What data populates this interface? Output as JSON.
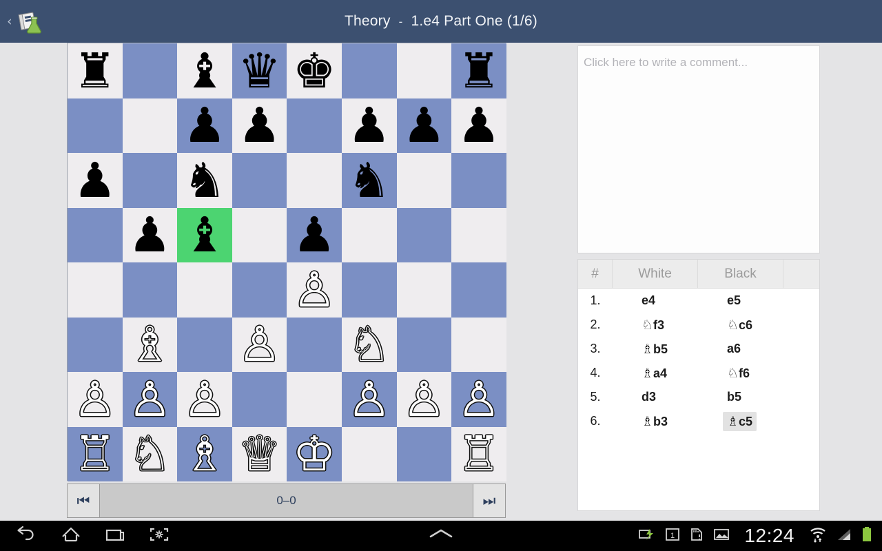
{
  "titlebar": {
    "back_label": "‹",
    "app_icon": "book-flask-icon",
    "title": "Theory",
    "separator": "-",
    "subtitle": "1.e4 Part One (1/6)"
  },
  "board": {
    "highlight_square": "c5",
    "squares": [
      {
        "sq": "a8",
        "shade": "light",
        "piece": "♜"
      },
      {
        "sq": "b8",
        "shade": "dark",
        "piece": ""
      },
      {
        "sq": "c8",
        "shade": "light",
        "piece": "♝"
      },
      {
        "sq": "d8",
        "shade": "dark",
        "piece": "♛"
      },
      {
        "sq": "e8",
        "shade": "light",
        "piece": "♚"
      },
      {
        "sq": "f8",
        "shade": "dark",
        "piece": ""
      },
      {
        "sq": "g8",
        "shade": "light",
        "piece": ""
      },
      {
        "sq": "h8",
        "shade": "dark",
        "piece": "♜"
      },
      {
        "sq": "a7",
        "shade": "dark",
        "piece": ""
      },
      {
        "sq": "b7",
        "shade": "light",
        "piece": ""
      },
      {
        "sq": "c7",
        "shade": "dark",
        "piece": "♟"
      },
      {
        "sq": "d7",
        "shade": "light",
        "piece": "♟"
      },
      {
        "sq": "e7",
        "shade": "dark",
        "piece": ""
      },
      {
        "sq": "f7",
        "shade": "light",
        "piece": "♟"
      },
      {
        "sq": "g7",
        "shade": "dark",
        "piece": "♟"
      },
      {
        "sq": "h7",
        "shade": "light",
        "piece": "♟"
      },
      {
        "sq": "a6",
        "shade": "light",
        "piece": "♟"
      },
      {
        "sq": "b6",
        "shade": "dark",
        "piece": ""
      },
      {
        "sq": "c6",
        "shade": "light",
        "piece": "♞"
      },
      {
        "sq": "d6",
        "shade": "dark",
        "piece": ""
      },
      {
        "sq": "e6",
        "shade": "light",
        "piece": ""
      },
      {
        "sq": "f6",
        "shade": "dark",
        "piece": "♞"
      },
      {
        "sq": "g6",
        "shade": "light",
        "piece": ""
      },
      {
        "sq": "h6",
        "shade": "dark",
        "piece": ""
      },
      {
        "sq": "a5",
        "shade": "dark",
        "piece": ""
      },
      {
        "sq": "b5",
        "shade": "light",
        "piece": "♟"
      },
      {
        "sq": "c5",
        "shade": "hl",
        "piece": "♝"
      },
      {
        "sq": "d5",
        "shade": "light",
        "piece": ""
      },
      {
        "sq": "e5",
        "shade": "dark",
        "piece": "♟"
      },
      {
        "sq": "f5",
        "shade": "light",
        "piece": ""
      },
      {
        "sq": "g5",
        "shade": "dark",
        "piece": ""
      },
      {
        "sq": "h5",
        "shade": "light",
        "piece": ""
      },
      {
        "sq": "a4",
        "shade": "light",
        "piece": ""
      },
      {
        "sq": "b4",
        "shade": "dark",
        "piece": ""
      },
      {
        "sq": "c4",
        "shade": "light",
        "piece": ""
      },
      {
        "sq": "d4",
        "shade": "dark",
        "piece": ""
      },
      {
        "sq": "e4",
        "shade": "light",
        "piece": "♙"
      },
      {
        "sq": "f4",
        "shade": "dark",
        "piece": ""
      },
      {
        "sq": "g4",
        "shade": "light",
        "piece": ""
      },
      {
        "sq": "h4",
        "shade": "dark",
        "piece": ""
      },
      {
        "sq": "a3",
        "shade": "dark",
        "piece": ""
      },
      {
        "sq": "b3",
        "shade": "light",
        "piece": "♗"
      },
      {
        "sq": "c3",
        "shade": "dark",
        "piece": ""
      },
      {
        "sq": "d3",
        "shade": "light",
        "piece": "♙"
      },
      {
        "sq": "e3",
        "shade": "dark",
        "piece": ""
      },
      {
        "sq": "f3",
        "shade": "light",
        "piece": "♘"
      },
      {
        "sq": "g3",
        "shade": "dark",
        "piece": ""
      },
      {
        "sq": "h3",
        "shade": "light",
        "piece": ""
      },
      {
        "sq": "a2",
        "shade": "light",
        "piece": "♙"
      },
      {
        "sq": "b2",
        "shade": "dark",
        "piece": "♙"
      },
      {
        "sq": "c2",
        "shade": "light",
        "piece": "♙"
      },
      {
        "sq": "d2",
        "shade": "dark",
        "piece": ""
      },
      {
        "sq": "e2",
        "shade": "light",
        "piece": ""
      },
      {
        "sq": "f2",
        "shade": "dark",
        "piece": "♙"
      },
      {
        "sq": "g2",
        "shade": "light",
        "piece": "♙"
      },
      {
        "sq": "h2",
        "shade": "dark",
        "piece": "♙"
      },
      {
        "sq": "a1",
        "shade": "dark",
        "piece": "♖"
      },
      {
        "sq": "b1",
        "shade": "light",
        "piece": "♘"
      },
      {
        "sq": "c1",
        "shade": "dark",
        "piece": "♗"
      },
      {
        "sq": "d1",
        "shade": "light",
        "piece": "♕"
      },
      {
        "sq": "e1",
        "shade": "dark",
        "piece": "♔"
      },
      {
        "sq": "f1",
        "shade": "light",
        "piece": ""
      },
      {
        "sq": "g1",
        "shade": "dark",
        "piece": ""
      },
      {
        "sq": "h1",
        "shade": "light",
        "piece": "♖"
      }
    ]
  },
  "board_nav": {
    "first_icon": "skip-to-start-icon",
    "first_glyph": "⏮",
    "last_icon": "skip-to-end-icon",
    "last_glyph": "⏭",
    "center_label": "0–0"
  },
  "comment": {
    "placeholder": "Click here to write a comment...",
    "value": ""
  },
  "moves": {
    "headers": [
      "#",
      "White",
      "Black",
      ""
    ],
    "active_move": "♝c5",
    "rows": [
      {
        "num": "1.",
        "white_piece": "",
        "white": "e4",
        "black_piece": "",
        "black": "e5",
        "white_active": false,
        "black_active": false
      },
      {
        "num": "2.",
        "white_piece": "♘",
        "white": "f3",
        "black_piece": "♘",
        "black": "c6",
        "white_active": false,
        "black_active": false
      },
      {
        "num": "3.",
        "white_piece": "♗",
        "white": "b5",
        "black_piece": "",
        "black": "a6",
        "white_active": false,
        "black_active": false
      },
      {
        "num": "4.",
        "white_piece": "♗",
        "white": "a4",
        "black_piece": "♘",
        "black": "f6",
        "white_active": false,
        "black_active": false
      },
      {
        "num": "5.",
        "white_piece": "",
        "white": "d3",
        "black_piece": "",
        "black": "b5",
        "white_active": false,
        "black_active": false
      },
      {
        "num": "6.",
        "white_piece": "♗",
        "white": "b3",
        "black_piece": "♗",
        "black": "c5",
        "white_active": false,
        "black_active": true
      }
    ]
  },
  "systembar": {
    "back_icon": "back-arrow-icon",
    "home_icon": "home-icon",
    "recents_icon": "recent-apps-icon",
    "screenshot_icon": "screenshot-icon",
    "expand_icon": "expand-chevron-icon",
    "usb_icon": "usb-charging-icon",
    "calendar_icon": "calendar-icon",
    "calendar_day": "1",
    "sdcard_icon": "sdcard-alert-icon",
    "image_icon": "image-icon",
    "clock": "12:24",
    "wifi_icon": "wifi-icon",
    "signal_icon": "cellular-signal-icon",
    "battery_icon": "battery-icon"
  },
  "colors": {
    "titlebar": "#3c5070",
    "board_light": "#efedef",
    "board_dark": "#7b8fc4",
    "highlight": "#4cd471",
    "page_bg": "#e4e4e6"
  }
}
